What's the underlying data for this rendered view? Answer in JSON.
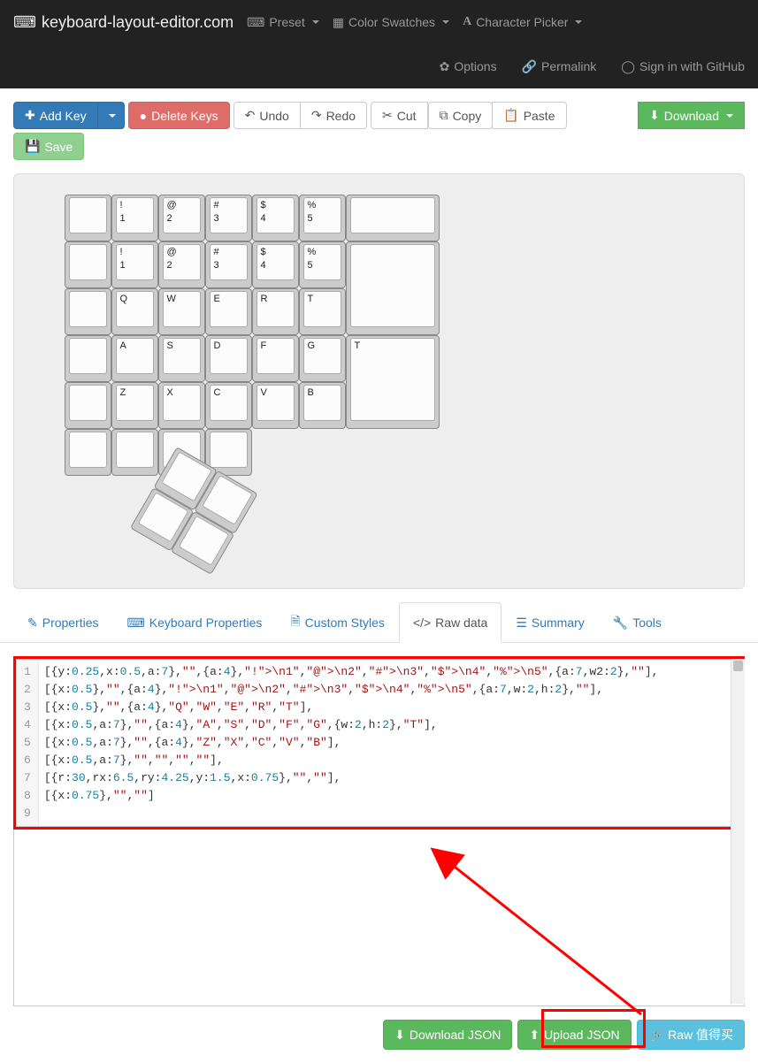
{
  "nav": {
    "brand": "keyboard-layout-editor.com",
    "preset": "Preset",
    "swatches": "Color Swatches",
    "picker": "Character Picker",
    "options": "Options",
    "permalink": "Permalink",
    "signin": "Sign in with GitHub"
  },
  "toolbar": {
    "add": "Add Key",
    "delete": "Delete Keys",
    "undo": "Undo",
    "redo": "Redo",
    "cut": "Cut",
    "copy": "Copy",
    "paste": "Paste",
    "download": "Download",
    "save": "Save"
  },
  "keyboard": {
    "unit": 53,
    "rows": [
      {
        "x": 0.5,
        "y": 0.25,
        "keys": [
          {
            "w": 1
          },
          {
            "top": "!",
            "bot": "1",
            "w": 1
          },
          {
            "top": "@",
            "bot": "2",
            "w": 1
          },
          {
            "top": "#",
            "bot": "3",
            "w": 1
          },
          {
            "top": "$",
            "bot": "4",
            "w": 1
          },
          {
            "top": "%",
            "bot": "5",
            "w": 1
          },
          {
            "w": 2
          }
        ]
      },
      {
        "x": 0.5,
        "y": 1.25,
        "keys": [
          {
            "w": 1
          },
          {
            "top": "!",
            "bot": "1",
            "w": 1
          },
          {
            "top": "@",
            "bot": "2",
            "w": 1
          },
          {
            "top": "#",
            "bot": "3",
            "w": 1
          },
          {
            "top": "$",
            "bot": "4",
            "w": 1
          },
          {
            "top": "%",
            "bot": "5",
            "w": 1
          },
          {
            "w": 2,
            "h": 2
          }
        ]
      },
      {
        "x": 0.5,
        "y": 2.25,
        "keys": [
          {
            "w": 1
          },
          {
            "top": "Q",
            "w": 1
          },
          {
            "top": "W",
            "w": 1
          },
          {
            "top": "E",
            "w": 1
          },
          {
            "top": "R",
            "w": 1
          },
          {
            "top": "T",
            "w": 1
          }
        ]
      },
      {
        "x": 0.5,
        "y": 3.25,
        "keys": [
          {
            "w": 1
          },
          {
            "top": "A",
            "w": 1
          },
          {
            "top": "S",
            "w": 1
          },
          {
            "top": "D",
            "w": 1
          },
          {
            "top": "F",
            "w": 1
          },
          {
            "top": "G",
            "w": 1
          },
          {
            "top": "T",
            "w": 2,
            "h": 2
          }
        ]
      },
      {
        "x": 0.5,
        "y": 4.25,
        "keys": [
          {
            "w": 1
          },
          {
            "top": "Z",
            "w": 1
          },
          {
            "top": "X",
            "w": 1
          },
          {
            "top": "C",
            "w": 1
          },
          {
            "top": "V",
            "w": 1
          },
          {
            "top": "B",
            "w": 1
          }
        ]
      },
      {
        "x": 0.5,
        "y": 5.25,
        "keys": [
          {
            "w": 1
          },
          {
            "w": 1
          },
          {
            "w": 1
          },
          {
            "w": 1
          }
        ]
      }
    ],
    "cluster": {
      "rx": 6.5,
      "ry": 4.25,
      "r": 30,
      "rows": [
        {
          "x": 0.75,
          "y": 1.5,
          "keys": [
            {
              "w": 1
            },
            {
              "w": 1
            }
          ]
        },
        {
          "x": 0.75,
          "y": 2.5,
          "keys": [
            {
              "w": 1
            },
            {
              "w": 1
            }
          ]
        }
      ]
    }
  },
  "tabs": {
    "properties": "Properties",
    "kbprops": "Keyboard Properties",
    "styles": "Custom Styles",
    "raw": "Raw data",
    "summary": "Summary",
    "tools": "Tools"
  },
  "raw": {
    "lines": [
      "[{y:0.25,x:0.5,a:7},\"\",{a:4},\"!\\n1\",\"@\\n2\",\"#\\n3\",\"$\\n4\",\"%\\n5\",{a:7,w2:2},\"\"],",
      "[{x:0.5},\"\",{a:4},\"!\\n1\",\"@\\n2\",\"#\\n3\",\"$\\n4\",\"%\\n5\",{a:7,w:2,h:2},\"\"],",
      "[{x:0.5},\"\",{a:4},\"Q\",\"W\",\"E\",\"R\",\"T\"],",
      "[{x:0.5,a:7},\"\",{a:4},\"A\",\"S\",\"D\",\"F\",\"G\",{w:2,h:2},\"T\"],",
      "[{x:0.5,a:7},\"\",{a:4},\"Z\",\"X\",\"C\",\"V\",\"B\"],",
      "[{x:0.5,a:7},\"\",\"\",\"\",\"\"],",
      "[{r:30,rx:6.5,ry:4.25,y:1.5,x:0.75},\"\",\"\"],",
      "[{x:0.75},\"\",\"\"]",
      ""
    ]
  },
  "footer": {
    "download_json": "Download JSON",
    "upload_json": "Upload JSON",
    "raw_permalink": "Raw 值得买"
  }
}
